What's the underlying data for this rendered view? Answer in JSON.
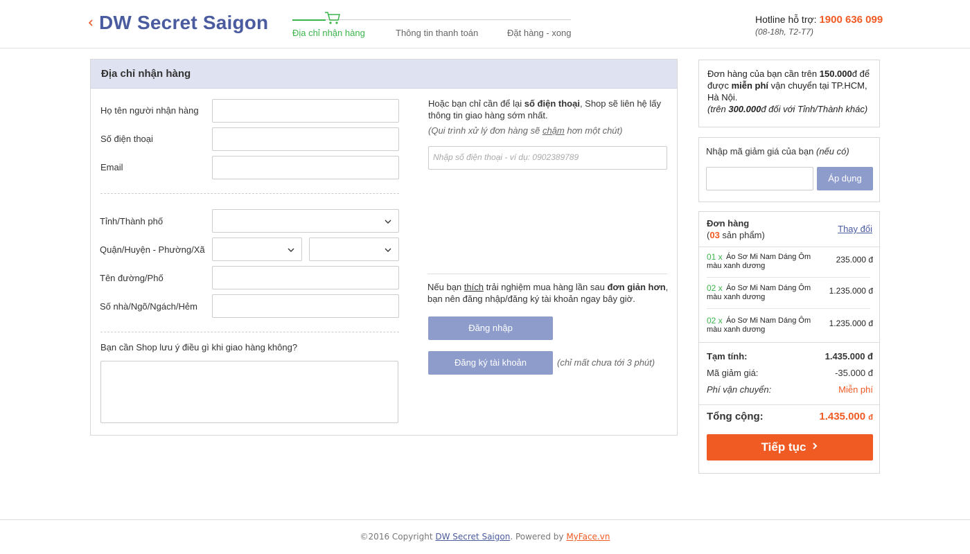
{
  "header": {
    "brand": "DW Secret Saigon",
    "steps": [
      "Địa chỉ nhận hàng",
      "Thông tin thanh toán",
      "Đặt hàng - xong"
    ],
    "active_step": 0,
    "hotline_label": "Hotline hỗ trợ: ",
    "hotline_number": "1900 636 099",
    "hotline_hours": "(08-18h, T2-T7)"
  },
  "form": {
    "title": "Địa chỉ nhận hàng",
    "fields": {
      "name_label": "Họ tên người nhận hàng",
      "phone_label": "Số điện thoại",
      "email_label": "Email",
      "city_label": "Tỉnh/Thành phố",
      "district_label": "Quận/Huyện - Phường/Xã",
      "street_label": "Tên đường/Phố",
      "house_label": "Số nhà/Ngõ/Ngách/Hẻm",
      "note_label": "Bạn cần Shop lưu ý điều gì khi giao hàng không?"
    },
    "quick_phone": {
      "text_before": "Hoặc bạn chỉ cần để lại ",
      "text_bold": "số điện thoại",
      "text_after": ", Shop sẽ liên hệ lấy thông tin giao hàng sớm nhất.",
      "note_before": "(Qui trình xử lý đơn hàng sẽ ",
      "note_underline": "chậm",
      "note_after": " hơn một chút)",
      "placeholder": "Nhập số  điện thoại - ví dụ: 0902389789"
    },
    "account": {
      "text_1": "Nếu bạn ",
      "text_underline": "thích",
      "text_2": " trải nghiệm mua hàng lần sau ",
      "text_bold": "đơn giản hơn",
      "text_3": ", bạn nên đăng nhập/đăng ký tài khoản ngay bây giờ.",
      "login_label": "Đăng nhập",
      "register_label": "Đăng ký tài khoản",
      "register_note": "(chỉ mất chưa tới 3 phút)"
    }
  },
  "shipping_info": {
    "t1": "Đơn hàng của bạn cần trên ",
    "b1": "150.000",
    "t2": "đ để được ",
    "b2": "miễn phí",
    "t3": " vận chuyển tại TP.HCM, Hà Nội.",
    "i1": "(trên ",
    "ib": "300.000",
    "i2": "đ đối với Tỉnh/Thành khác)"
  },
  "coupon": {
    "label": "Nhập mã giảm giá của bạn ",
    "label_italic": "(nếu có)",
    "button": "Áp dụng"
  },
  "order": {
    "title": "Đơn hàng",
    "count_open": "(",
    "count": "03",
    "count_text": " sản phẩm)",
    "change_link": "Thay đổi",
    "items": [
      {
        "qty": "01 x",
        "name": "Áo Sơ Mi Nam Dáng Ôm màu xanh dương",
        "price": "235.000 đ"
      },
      {
        "qty": "02 x",
        "name": "Áo Sơ Mi Nam Dáng Ôm màu xanh dương",
        "price": "1.235.000 đ"
      },
      {
        "qty": "02 x",
        "name": "Áo Sơ Mi Nam Dáng Ôm màu xanh dương",
        "price": "1.235.000 đ"
      }
    ],
    "subtotal_label": "Tạm tính:",
    "subtotal_value": "1.435.000 đ",
    "discount_label": "Mã giảm giá:",
    "discount_value": "-35.000 đ",
    "shipping_label": "Phí vận chuyển:",
    "shipping_value": "Miễn phí",
    "total_label": "Tổng cộng:",
    "total_value": "1.435.000",
    "total_currency": "đ",
    "continue_label": "Tiếp tục"
  },
  "footer": {
    "copyright": "©2016 Copyright ",
    "brand": "DW Secret Saigon",
    "powered": ". Powered by ",
    "powered_by": "MyFace.vn"
  },
  "colors": {
    "brand": "#4a5b9f",
    "accent": "#f05a23",
    "success": "#3ab54a",
    "button_blue": "#8e9ccc",
    "panel_header": "#dfe2f0"
  }
}
